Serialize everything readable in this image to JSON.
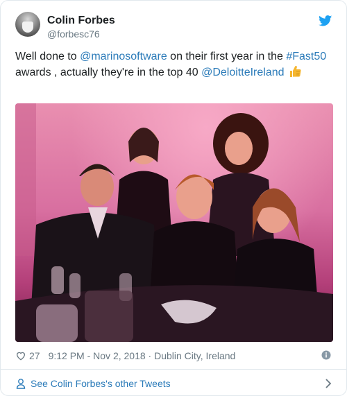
{
  "author": {
    "name": "Colin Forbes",
    "handle": "@forbesc76"
  },
  "tweet": {
    "part1": "Well done to ",
    "mention1": "@marinosoftware",
    "part2": " on their first year in the ",
    "hashtag": "#Fast50",
    "part3": " awards , actually they're in the top 40 ",
    "mention2": "@DeloitteIreland"
  },
  "meta": {
    "likes": "27",
    "timestamp": "9:12 PM - Nov 2, 2018 · Dublin City, Ireland"
  },
  "footer": {
    "see_more": "See Colin Forbes's other Tweets"
  },
  "colors": {
    "link": "#2b7bb9",
    "twitter_blue": "#1da1f2",
    "muted": "#697882"
  }
}
